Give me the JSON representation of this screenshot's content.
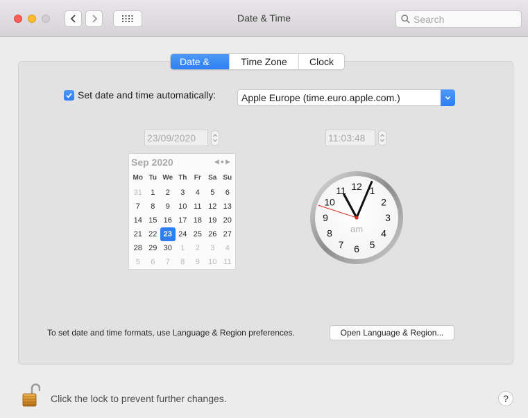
{
  "window": {
    "title": "Date & Time",
    "search_placeholder": "Search"
  },
  "tabs": [
    {
      "label": "Date & Time",
      "active": true
    },
    {
      "label": "Time Zone",
      "active": false
    },
    {
      "label": "Clock",
      "active": false
    }
  ],
  "auto": {
    "checked": true,
    "label": "Set date and time automatically:",
    "server": "Apple Europe (time.euro.apple.com.)"
  },
  "date_field": "23/09/2020",
  "time_field": "11:03:48",
  "calendar": {
    "month": "Sep 2020",
    "weekdays": [
      "Mo",
      "Tu",
      "We",
      "Th",
      "Fr",
      "Sa",
      "Su"
    ],
    "weeks": [
      [
        "31",
        "1",
        "2",
        "3",
        "4",
        "5",
        "6"
      ],
      [
        "7",
        "8",
        "9",
        "10",
        "11",
        "12",
        "13"
      ],
      [
        "14",
        "15",
        "16",
        "17",
        "18",
        "19",
        "20"
      ],
      [
        "21",
        "22",
        "23",
        "24",
        "25",
        "26",
        "27"
      ],
      [
        "28",
        "29",
        "30",
        "1",
        "2",
        "3",
        "4"
      ],
      [
        "5",
        "6",
        "7",
        "8",
        "9",
        "10",
        "11"
      ]
    ],
    "selected": "23"
  },
  "clock": {
    "numbers": [
      "12",
      "1",
      "2",
      "3",
      "4",
      "5",
      "6",
      "7",
      "8",
      "9",
      "10",
      "11"
    ],
    "period": "am",
    "hour": 11,
    "minute": 3,
    "second": 48
  },
  "footer": {
    "formats_text": "To set date and time formats, use Language & Region preferences.",
    "open_button": "Open Language & Region...",
    "lock_text": "Click the lock to prevent further changes.",
    "help": "?"
  },
  "colors": {
    "accent": "#2f7ff0",
    "close": "#fc5f57",
    "minimize": "#fdbc2e"
  }
}
